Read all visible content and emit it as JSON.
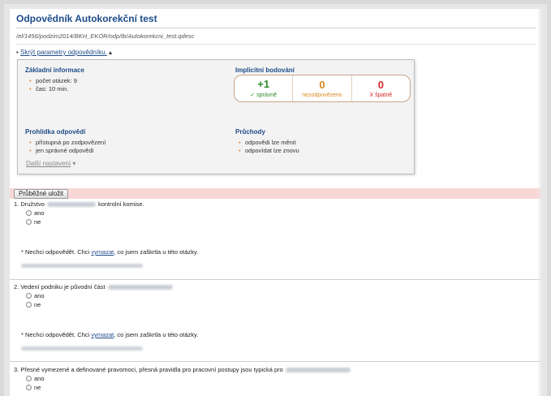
{
  "title": "Odpovědník Autokorekční test",
  "path": "/el/1456/podzim2014/BKH_EKOR/odp/tb/Autokorekcni_test.qdesc",
  "toggle_params": {
    "bullet": "•",
    "link": "Skrýt parametry odpovědníku.",
    "arrow": "▴"
  },
  "params": {
    "basic": {
      "heading": "Základní informace",
      "items": [
        "počet otázek: 9",
        "čas: 10 min."
      ]
    },
    "scoring": {
      "heading": "Implicitní bodování",
      "cells": [
        {
          "value": "+1",
          "label": "✓ správně",
          "color": "#2e8b2e"
        },
        {
          "value": "0",
          "label": "nezodpovězeno",
          "color": "#d98a1e"
        },
        {
          "value": "0",
          "label": "X špatně",
          "color": "#d62828"
        }
      ]
    },
    "review": {
      "heading": "Prohlídka odpovědí",
      "items": [
        "přístupná po zodpovězení",
        "jen správné odpovědi"
      ]
    },
    "passes": {
      "heading": "Průchody",
      "items": [
        "odpovědi lze měnit",
        "odpovídat lze znovu"
      ]
    },
    "more_settings": {
      "link": "Další nastavení",
      "arrow": "▾"
    }
  },
  "save_button": "Průběžné uložit",
  "questions": [
    {
      "before": "1. Družstvo",
      "after": "kontrolní komise.",
      "options": [
        "ano",
        "ne"
      ]
    },
    {
      "before": "2. Vedení podniku je původní část",
      "after": "",
      "options": [
        "ano",
        "ne"
      ]
    },
    {
      "before": "3. Přesné vymezené a definované pravomoci, přesná pravidla pro pracovní postupy jsou typická pro",
      "after": "",
      "options": [
        "ano",
        "ne"
      ]
    }
  ],
  "no_answer": {
    "prefix": "* Nechci odpovědět. Chci",
    "link": "vymazat",
    "suffix": ", co jsem zaškrtla u této otázky."
  }
}
